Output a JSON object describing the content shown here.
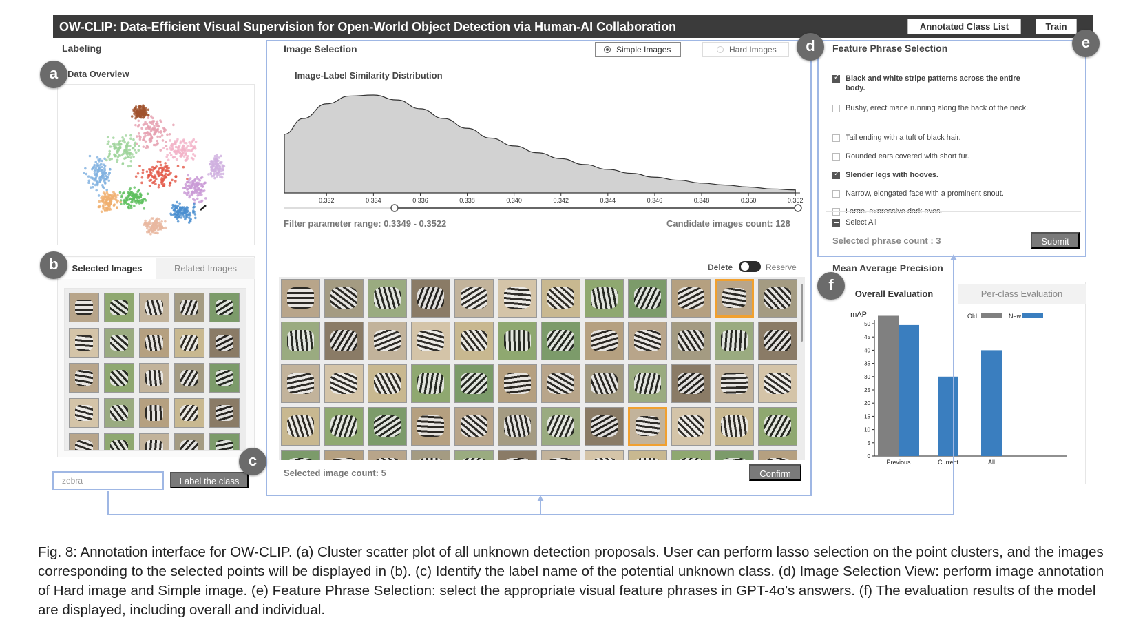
{
  "header": {
    "title": "OW-CLIP: Data-Efficient Visual Supervision for Open-World Object Detection via Human-AI Collaboration",
    "annotated_class_list": "Annotated Class List",
    "train": "Train"
  },
  "labeling": {
    "title": "Labeling",
    "data_overview": "Data Overview",
    "tabs": [
      "Selected Images",
      "Related Images"
    ],
    "class_input_value": "zebra",
    "label_button": "Label the class"
  },
  "badges": {
    "a": "a",
    "b": "b",
    "c": "c",
    "d": "d",
    "e": "e",
    "f": "f"
  },
  "image_selection": {
    "title": "Image Selection",
    "simple_images": "Simple Images",
    "hard_images": "Hard Images",
    "distribution_title": "Image-Label Similarity Distribution",
    "filter_range": "Filter parameter range: 0.3349 - 0.3522",
    "candidate_count": "Candidate images count: 128",
    "delete": "Delete",
    "reserve": "Reserve",
    "selected_count": "Selected image count: 5",
    "confirm": "Confirm"
  },
  "distribution_chart": {
    "type": "area",
    "x_ticks": [
      "0.332",
      "0.334",
      "0.336",
      "0.338",
      "0.340",
      "0.342",
      "0.344",
      "0.346",
      "0.348",
      "0.350",
      "0.352"
    ],
    "x": [
      0.3302,
      0.331,
      0.332,
      0.333,
      0.334,
      0.335,
      0.336,
      0.337,
      0.338,
      0.339,
      0.34,
      0.341,
      0.342,
      0.343,
      0.344,
      0.345,
      0.346,
      0.347,
      0.348,
      0.349,
      0.35,
      0.351,
      0.352
    ],
    "y": [
      0.6,
      0.76,
      0.91,
      0.99,
      1.0,
      0.95,
      0.86,
      0.76,
      0.66,
      0.56,
      0.48,
      0.41,
      0.35,
      0.29,
      0.24,
      0.2,
      0.16,
      0.13,
      0.1,
      0.08,
      0.06,
      0.04,
      0.03
    ],
    "xlim": [
      0.3302,
      0.3522
    ],
    "range": [
      0.3349,
      0.3522
    ]
  },
  "feature_phrases": {
    "title": "Feature Phrase Selection",
    "items": [
      {
        "text": "Black and white stripe patterns across the entire body.",
        "checked": true
      },
      {
        "text": "Bushy, erect mane running along the back of the neck.",
        "checked": false
      },
      {
        "text": "Tail ending with a tuft of black hair.",
        "checked": false
      },
      {
        "text": "Rounded ears covered with short fur.",
        "checked": false
      },
      {
        "text": "Slender legs with hooves.",
        "checked": true
      },
      {
        "text": "Narrow, elongated face with a prominent snout.",
        "checked": false
      },
      {
        "text": "Large, expressive dark eyes.",
        "checked": false
      }
    ],
    "select_all": "Select All",
    "selected_count": "Selected phrase count : 3",
    "submit": "Submit"
  },
  "map": {
    "title": "Mean Average Precision",
    "tabs": [
      "Overall Evaluation",
      "Per-class Evaluation"
    ]
  },
  "chart_data": {
    "type": "bar",
    "categories": [
      "Previous",
      "Current",
      "All"
    ],
    "series": [
      {
        "name": "Old",
        "color": "#808080",
        "values": [
          53,
          null,
          null
        ]
      },
      {
        "name": "New",
        "color": "#3a7ebf",
        "values": [
          49.5,
          30,
          40
        ]
      }
    ],
    "ylabel": "mAP",
    "ylim": [
      0,
      50
    ],
    "y_ticks": [
      0,
      5,
      10,
      15,
      20,
      25,
      30,
      35,
      40,
      45,
      50
    ],
    "legend": "top-right"
  },
  "caption": "Fig. 8: Annotation interface for OW-CLIP. (a) Cluster scatter plot of all unknown detection proposals. User can perform lasso selection on the point clusters, and the images corresponding to the selected points will be displayed in (b). (c) Identify the label name of the potential unknown class. (d) Image Selection View: perform image annotation of Hard image and Simple image. (e) Feature Phrase Selection: select the appropriate visual feature phrases in GPT-4o’s answers. (f) The evaluation results of the model are displayed, including overall and individual.",
  "colors": {
    "accent_blue": "#8fa9d8",
    "bar_new": "#3a7ebf",
    "bar_old": "#808080",
    "selection_orange": "#f0a030"
  }
}
